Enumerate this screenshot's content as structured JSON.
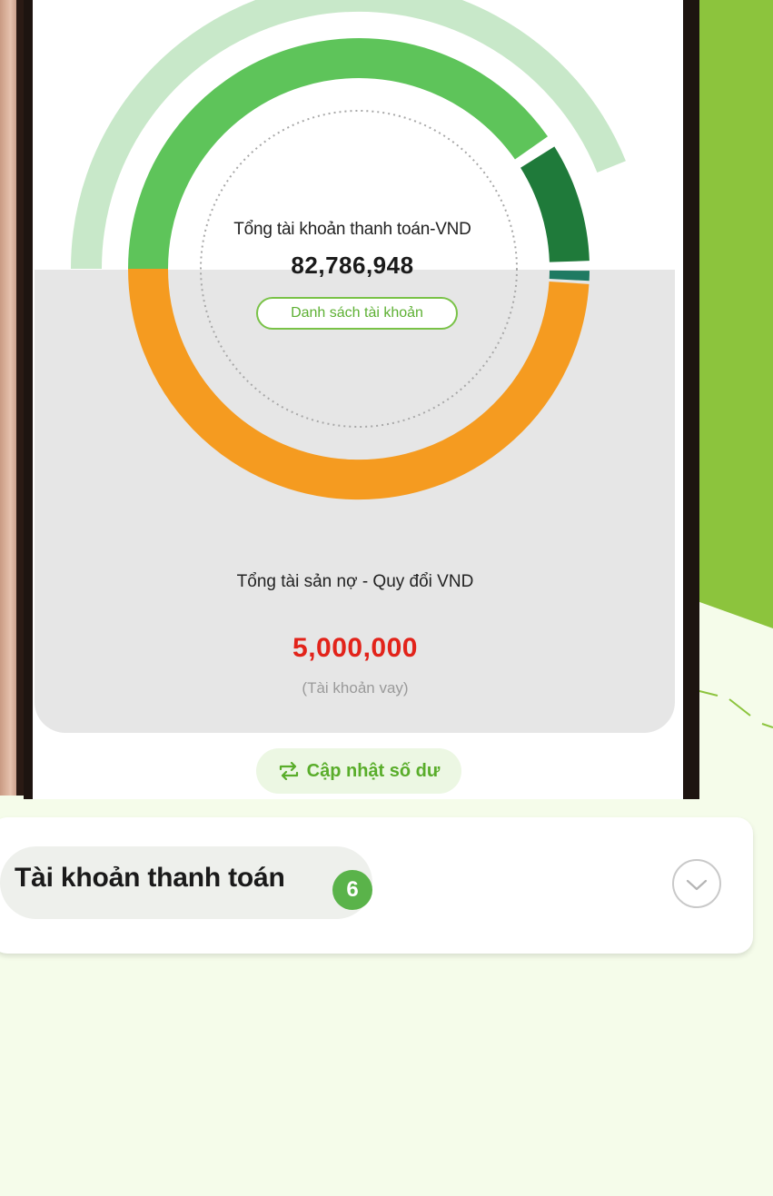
{
  "summary": {
    "label": "Tổng tài khoản thanh toán-VND",
    "value": "82,786,948",
    "account_list_button": "Danh sách tài khoản"
  },
  "debt": {
    "label": "Tổng tài sản nợ - Quy đổi VND",
    "value": "5,000,000",
    "note": "(Tài khoản vay)"
  },
  "refresh_button": "Cập nhật số dư",
  "section": {
    "title": "Tài khoản thanh toán",
    "count": "6"
  },
  "colors": {
    "primary_green": "#5ec45a",
    "light_green": "#c8e8c9",
    "dark_green": "#1f7a3a",
    "teal": "#1f7a62",
    "orange": "#f59b20",
    "debt_red": "#e2231a",
    "accent_green": "#8cc43d"
  },
  "icons": {
    "refresh": "refresh-arrows-icon",
    "chevron": "chevron-down-icon"
  }
}
